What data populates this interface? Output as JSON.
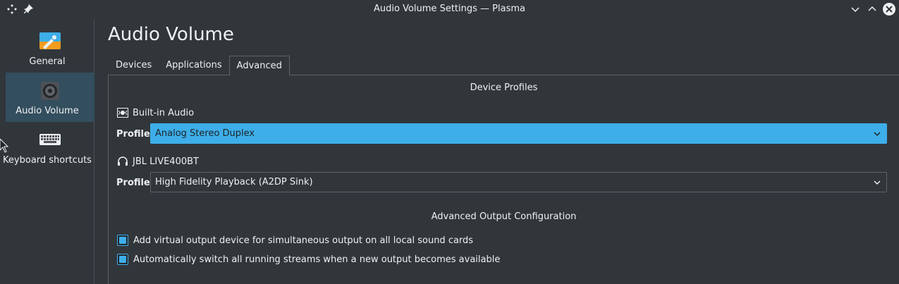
{
  "window": {
    "title": "Audio Volume Settings — Plasma"
  },
  "titlebar_icons": [
    "move-icon",
    "pin-icon",
    "minimize-icon",
    "maximize-icon",
    "close-icon"
  ],
  "sidebar": {
    "items": [
      {
        "label": "General",
        "icon": "general-icon",
        "active": false
      },
      {
        "label": "Audio Volume",
        "icon": "speaker-icon",
        "active": true
      },
      {
        "label": "Keyboard shortcuts",
        "icon": "keyboard-icon",
        "active": false
      }
    ]
  },
  "main": {
    "title": "Audio Volume",
    "tabs": [
      {
        "label": "Devices",
        "active": false
      },
      {
        "label": "Applications",
        "active": false
      },
      {
        "label": "Advanced",
        "active": true
      }
    ],
    "device_profiles": {
      "heading": "Device Profiles",
      "devices": [
        {
          "name": "Built-in Audio",
          "icon": "sound-card-icon",
          "profile_label": "Profile:",
          "profile": "Analog Stereo Duplex",
          "focused": true
        },
        {
          "name": "JBL LIVE400BT",
          "icon": "headphones-icon",
          "profile_label": "Profile:",
          "profile": "High Fidelity Playback (A2DP Sink)",
          "focused": false
        }
      ]
    },
    "advanced_output": {
      "heading": "Advanced Output Configuration",
      "options": [
        {
          "label": "Add virtual output device for simultaneous output on all local sound cards",
          "checked": true
        },
        {
          "label": "Automatically switch all running streams when a new output becomes available",
          "checked": true
        }
      ]
    }
  },
  "colors": {
    "background": "#31363b",
    "accent": "#3daee9",
    "selection": "#334e5e",
    "text": "#eff0f1"
  }
}
